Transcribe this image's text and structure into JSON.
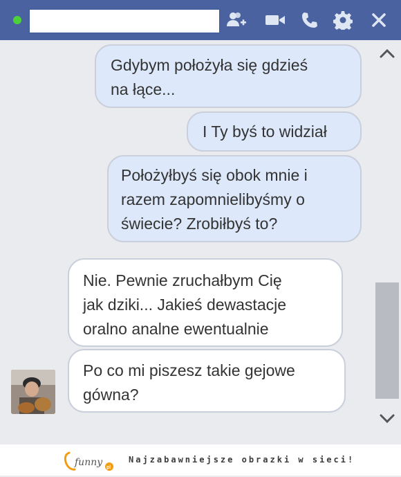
{
  "header": {
    "icons": [
      "add-friend-icon",
      "video-call-icon",
      "phone-call-icon",
      "settings-icon",
      "close-icon"
    ],
    "status_color": "#4cd137",
    "bar_color": "#4a62a0"
  },
  "messages": [
    {
      "direction": "sent",
      "lines": [
        "Gdybym położyła się gdzieś",
        "na łące..."
      ]
    },
    {
      "direction": "sent",
      "lines": [
        "I Ty byś to widział"
      ]
    },
    {
      "direction": "sent",
      "lines": [
        "Położyłbyś się obok mnie i",
        "razem zapomnielibyśmy o",
        "świecie? Zrobiłbyś to?"
      ]
    },
    {
      "direction": "received",
      "lines": [
        "Nie. Pewnie zruchałbym Cię",
        "jak dziki... Jakieś dewastacje",
        "oralno analne ewentualnie"
      ]
    },
    {
      "direction": "received",
      "lines": [
        "Po co mi piszesz takie gejowe",
        "gówna?"
      ]
    }
  ],
  "footer": {
    "logo_text": "funny",
    "logo_badge": "pl",
    "slogan": "Najzabawniejsze obrazki w sieci!"
  }
}
